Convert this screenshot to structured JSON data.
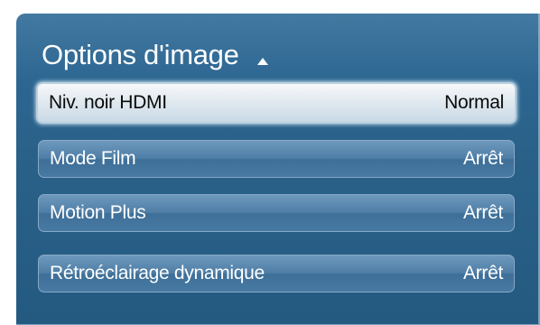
{
  "menu": {
    "title": "Options d'image",
    "items": [
      {
        "label": "Niv. noir HDMI",
        "value": "Normal",
        "selected": true
      },
      {
        "label": "Mode Film",
        "value": "Arrêt",
        "selected": false
      },
      {
        "label": "Motion Plus",
        "value": "Arrêt",
        "selected": false
      },
      {
        "label": "Rétroéclairage dynamique",
        "value": "Arrêt",
        "selected": false
      }
    ]
  },
  "colors": {
    "panel_background": "#2a6189",
    "item_background": "#4f7ea6",
    "selected_background": "#dfe8ef",
    "text_light": "#ffffff",
    "text_dark": "#0a0a0a"
  },
  "icons": {
    "scroll_up": "up-arrow-icon"
  }
}
